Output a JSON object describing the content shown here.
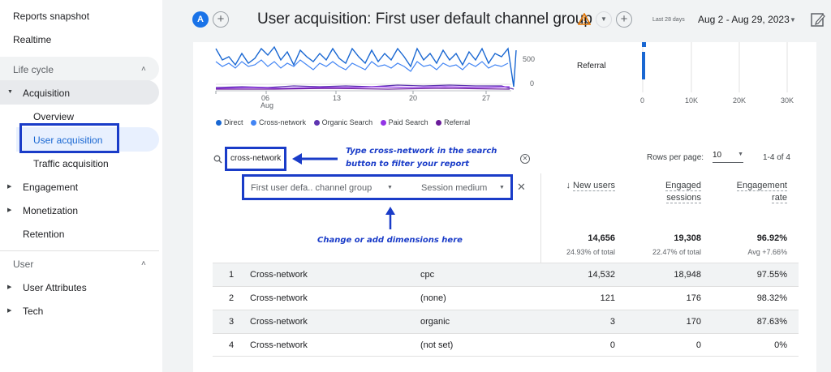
{
  "sidebar": {
    "reports_snapshot": "Reports snapshot",
    "realtime": "Realtime",
    "lifecycle_title": "Life cycle",
    "acquisition": "Acquisition",
    "overview": "Overview",
    "user_acquisition": "User acquisition",
    "traffic_acquisition": "Traffic acquisition",
    "engagement": "Engagement",
    "monetization": "Monetization",
    "retention": "Retention",
    "user_title": "User",
    "user_attributes": "User Attributes",
    "tech": "Tech"
  },
  "header": {
    "avatar_letter": "A",
    "add_comparison": "+",
    "title": "User acquisition: First user default channel group",
    "date_prefix": "Last 28 days",
    "date_range": "Aug 2 - Aug 29, 2023"
  },
  "chart": {
    "y_ticks": [
      "500",
      "0"
    ],
    "x_ticks": [
      "06",
      "13",
      "20",
      "27"
    ],
    "x_month": "Aug",
    "bar_label": "Referral",
    "bar_ticks": [
      "0",
      "10K",
      "20K",
      "30K"
    ],
    "legend": [
      {
        "label": "Direct",
        "color": "#1967d2"
      },
      {
        "label": "Cross-network",
        "color": "#4285f4"
      },
      {
        "label": "Organic Search",
        "color": "#5e35b1"
      },
      {
        "label": "Paid Search",
        "color": "#9334e6"
      },
      {
        "label": "Referral",
        "color": "#6a1b9a"
      }
    ]
  },
  "search": {
    "value": "cross-network"
  },
  "annotations": {
    "search_note_line1": "Type cross-network in the search",
    "search_note_line2": "button to filter your report",
    "dimension_note": "Change or add dimensions here"
  },
  "pagination": {
    "rows_label": "Rows per page:",
    "rows_value": "10",
    "range": "1-4 of 4"
  },
  "dimensions": {
    "primary": "First user defa.. channel group",
    "secondary": "Session medium"
  },
  "columns": {
    "new_users": "New users",
    "engaged_sessions_1": "Engaged",
    "engaged_sessions_2": "sessions",
    "engagement_rate_1": "Engagement",
    "engagement_rate_2": "rate"
  },
  "totals": {
    "new_users": "14,656",
    "new_users_sub": "24.93% of total",
    "engaged_sessions": "19,308",
    "engaged_sessions_sub": "22.47% of total",
    "engagement_rate": "96.92%",
    "engagement_rate_sub": "Avg +7.66%"
  },
  "rows": [
    {
      "idx": "1",
      "channel": "Cross-network",
      "medium": "cpc",
      "new_users": "14,532",
      "engaged": "18,948",
      "rate": "97.55%"
    },
    {
      "idx": "2",
      "channel": "Cross-network",
      "medium": "(none)",
      "new_users": "121",
      "engaged": "176",
      "rate": "98.32%"
    },
    {
      "idx": "3",
      "channel": "Cross-network",
      "medium": "organic",
      "new_users": "3",
      "engaged": "170",
      "rate": "87.63%"
    },
    {
      "idx": "4",
      "channel": "Cross-network",
      "medium": "(not set)",
      "new_users": "0",
      "engaged": "0",
      "rate": "0%"
    }
  ]
}
